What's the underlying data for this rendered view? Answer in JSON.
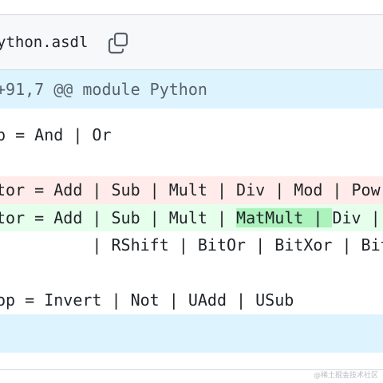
{
  "file": {
    "name": "ython.asdl",
    "copy_icon": "copy-icon"
  },
  "diff": {
    "hunk_header": "+91,7 @@ module Python",
    "lines": {
      "boolop": "p = And | Or",
      "operator_del": "tor = Add | Sub | Mult | Div | Mod | Pow",
      "operator_add_pre": "tor = Add | Sub | Mult | ",
      "operator_add_hl": "MatMult | ",
      "operator_add_post": "Div | Mod | Pow",
      "operator_cont": "          | RShift | BitOr | BitXor | BitAnd",
      "unaryop": "op = Invert | Not | UAdd | USub"
    }
  },
  "watermark": "@稀土掘金技术社区",
  "colors": {
    "hunk_bg": "#ddf4ff",
    "deletion_bg": "#ffebe9",
    "addition_bg": "#e6ffec",
    "addition_highlight": "#abf2bc",
    "header_bg": "#f6f8fa",
    "border": "#d0d7de"
  }
}
